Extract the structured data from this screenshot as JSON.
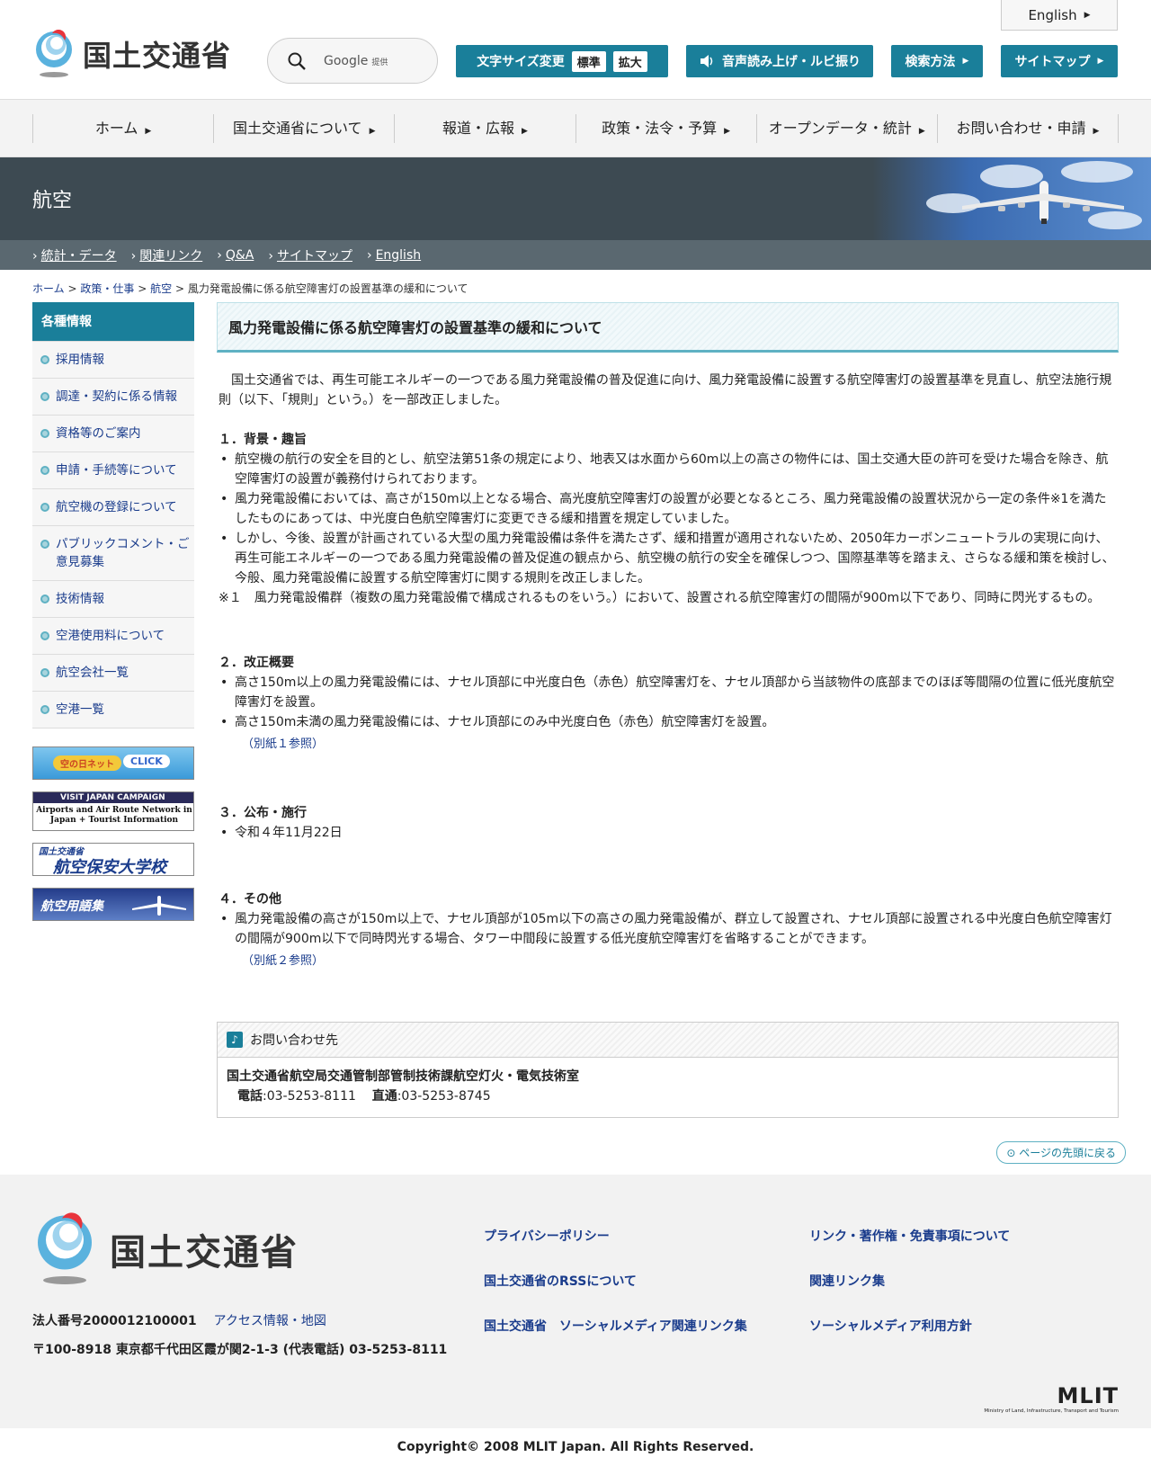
{
  "header": {
    "logo_text": "国土交通省",
    "search_placeholder": "Google",
    "search_provided": "提供",
    "english": "English",
    "fontsize_label": "文字サイズ変更",
    "fontsize_standard": "標準",
    "fontsize_large": "拡大",
    "voice_label": "音声読み上げ・ルビ振り",
    "howto_label": "検索方法",
    "sitemap_label": "サイトマップ"
  },
  "gnav": [
    "ホーム",
    "国土交通省について",
    "報道・広報",
    "政策・法令・予算",
    "オープンデータ・統計",
    "お問い合わせ・申請"
  ],
  "banner": {
    "title": "航空"
  },
  "subnav": [
    "統計・データ",
    "関連リンク",
    "Q&A",
    "サイトマップ",
    "English"
  ],
  "breadcrumb": {
    "home": "ホーム",
    "sep": ">",
    "policy": "政策・仕事",
    "aviation": "航空",
    "current": "風力発電設備に係る航空障害灯の設置基準の緩和について"
  },
  "sidebar": {
    "heading": "各種情報",
    "items": [
      "採用情報",
      "調達・契約に係る情報",
      "資格等のご案内",
      "申請・手続等について",
      "航空機の登録について",
      "パブリックコメント・ご意見募集",
      "技術情報",
      "空港使用料について",
      "航空会社一覧",
      "空港一覧"
    ],
    "banners": {
      "sora_text": "空の日ネット",
      "sora_click": "CLICK",
      "vjc_line1": "VISIT JAPAN CAMPAIGN",
      "vjc_line2": "Airports and Air Route Network in Japan + Tourist Information",
      "school_line1": "国土交通省",
      "school_line2": "航空保安大学校",
      "glossary": "航空用語集"
    }
  },
  "main": {
    "title": "風力発電設備に係る航空障害灯の設置基準の緩和について",
    "lead": "国土交通省では、再生可能エネルギーの一つである風力発電設備の普及促進に向け、風力発電設備に設置する航空障害灯の設置基準を見直し、航空法施行規則（以下、「規則」という。）を一部改正しました。",
    "s1_title": "１．背景・趣旨",
    "s1_items": [
      "航空機の航行の安全を目的とし、航空法第51条の規定により、地表又は水面から60m以上の高さの物件には、国土交通大臣の許可を受けた場合を除き、航空障害灯の設置が義務付けられております。",
      "風力発電設備においては、高さが150m以上となる場合、高光度航空障害灯の設置が必要となるところ、風力発電設備の設置状況から一定の条件※1を満たしたものにあっては、中光度白色航空障害灯に変更できる緩和措置を規定していました。",
      "しかし、今後、設置が計画されている大型の風力発電設備は条件を満たさず、緩和措置が適用されないため、2050年カーボンニュートラルの実現に向け、再生可能エネルギーの一つである風力発電設備の普及促進の観点から、航空機の航行の安全を確保しつつ、国際基準等を踏まえ、さらなる緩和策を検討し、今般、風力発電設備に設置する航空障害灯に関する規則を改正しました。"
    ],
    "s1_note": "※１　風力発電設備群（複数の風力発電設備で構成されるものをいう。）において、設置される航空障害灯の間隔が900m以下であり、同時に閃光するもの。",
    "s2_title": "２．改正概要",
    "s2_items": [
      "高さ150m以上の風力発電設備には、ナセル頂部に中光度白色（赤色）航空障害灯を、ナセル頂部から当該物件の底部までのほぼ等間隔の位置に低光度航空障害灯を設置。",
      "高さ150m未満の風力発電設備には、ナセル頂部にのみ中光度白色（赤色）航空障害灯を設置。"
    ],
    "s2_ref": "（別紙１参照）",
    "s3_title": "３．公布・施行",
    "s3_items": [
      "令和４年11月22日"
    ],
    "s4_title": "４．その他",
    "s4_items": [
      "風力発電設備の高さが150m以上で、ナセル頂部が105m以下の高さの風力発電設備が、群立して設置され、ナセル頂部に設置される中光度白色航空障害灯の間隔が900m以下で同時閃光する場合、タワー中間段に設置する低光度航空障害灯を省略することができます。"
    ],
    "s4_ref": "（別紙２参照）"
  },
  "contact": {
    "heading": "お問い合わせ先",
    "org": "国土交通省航空局交通管制部管制技術課航空灯火・電気技術室",
    "tel_label": "電話",
    "tel": ":03-5253-8111",
    "direct_label": "直通",
    "direct": ":03-5253-8745"
  },
  "totop": "ページの先頭に戻る",
  "footer": {
    "logo_text": "国土交通省",
    "corp_no": "法人番号2000012100001",
    "access": "アクセス情報・地図",
    "address": "〒100-8918 東京都千代田区霞が関2-1-3 (代表電話) 03-5253-8111",
    "links": [
      "プライバシーポリシー",
      "リンク・著作権・免責事項について",
      "国土交通省のRSSについて",
      "関連リンク集",
      "国土交通省　ソーシャルメディア関連リンク集",
      "ソーシャルメディア利用方針"
    ],
    "mlit": "MLIT",
    "mlit_sub": "Ministry of Land, Infrastructure, Transport and Tourism"
  },
  "copyright": "Copyright© 2008 MLIT Japan. All Rights Reserved.",
  "colors": {
    "teal": "#1a7f9a",
    "banner": "#3d4a52",
    "subnav": "#5a6870"
  }
}
